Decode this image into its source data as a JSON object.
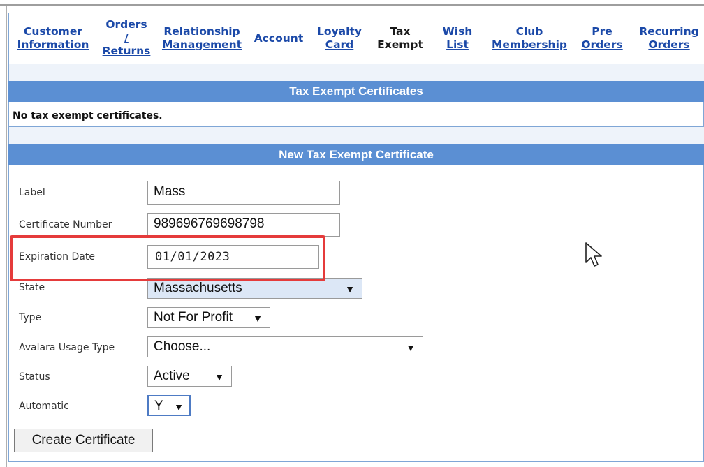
{
  "nav": {
    "customer_info": [
      "Customer",
      "Information"
    ],
    "orders_returns": [
      "Orders",
      "/",
      "Returns"
    ],
    "relationship": [
      "Relationship",
      "Management"
    ],
    "account": "Account",
    "loyalty": [
      "Loyalty",
      "Card"
    ],
    "tax_exempt": [
      "Tax",
      "Exempt"
    ],
    "wish_list": [
      "Wish",
      "List"
    ],
    "club": [
      "Club",
      "Membership"
    ],
    "pre_orders": [
      "Pre",
      "Orders"
    ],
    "recurring": [
      "Recurring",
      "Orders"
    ]
  },
  "certificates": {
    "title": "Tax Exempt Certificates",
    "empty_message": "No tax exempt certificates."
  },
  "new_certificate": {
    "title": "New Tax Exempt Certificate",
    "fields": {
      "label": {
        "label": "Label",
        "value": "Mass"
      },
      "certificate_number": {
        "label": "Certificate Number",
        "value": "989696769698798"
      },
      "expiration_date": {
        "label": "Expiration Date",
        "value": "01/01/2023"
      },
      "state": {
        "label": "State",
        "value": "Massachusetts"
      },
      "type": {
        "label": "Type",
        "value": "Not For Profit"
      },
      "avalara": {
        "label": "Avalara Usage Type",
        "value": "Choose..."
      },
      "status": {
        "label": "Status",
        "value": "Active"
      },
      "automatic": {
        "label": "Automatic",
        "value": "Y"
      }
    },
    "submit_label": "Create Certificate"
  },
  "colors": {
    "section_header": "#5b8fd3",
    "link": "#1b49a8",
    "highlight": "#e53b3b"
  },
  "icons": {
    "dropdown": "chevron-down-icon",
    "cursor": "mouse-pointer-icon"
  }
}
